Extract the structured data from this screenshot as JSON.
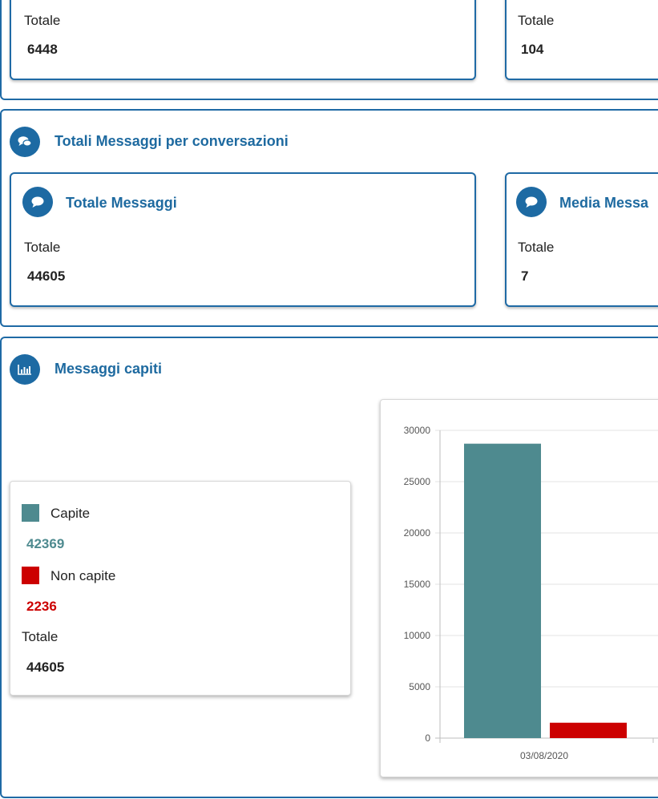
{
  "top_section": {
    "card_left": {
      "label": "Totale",
      "value": "6448"
    },
    "card_right": {
      "label": "Totale",
      "value": "104"
    }
  },
  "conversations_section": {
    "title": "Totali Messaggi per conversazioni",
    "icon": "chat-bubbles-icon",
    "card_total": {
      "title": "Totale Messaggi",
      "label": "Totale",
      "value": "44605"
    },
    "card_average": {
      "title": "Media Messa",
      "label": "Totale",
      "value": "7"
    }
  },
  "understood_section": {
    "title": "Messaggi capiti",
    "icon": "bar-chart-icon",
    "legend": {
      "items": [
        {
          "label": "Capite",
          "value": "42369",
          "color": "#4e8a8f"
        },
        {
          "label": "Non capite",
          "value": "2236",
          "color": "#cc0000"
        }
      ],
      "total_label": "Totale",
      "total_value": "44605"
    }
  },
  "chart_data": {
    "type": "bar",
    "categories": [
      "03/08/2020"
    ],
    "series": [
      {
        "values": [
          28700
        ],
        "color": "#4e8a8f"
      },
      {
        "values": [
          1500
        ],
        "color": "#cc0000"
      }
    ],
    "y_ticks": [
      "0",
      "5000",
      "10000",
      "15000",
      "20000",
      "25000",
      "30000"
    ],
    "ylim": [
      0,
      30000
    ],
    "grid": true
  }
}
